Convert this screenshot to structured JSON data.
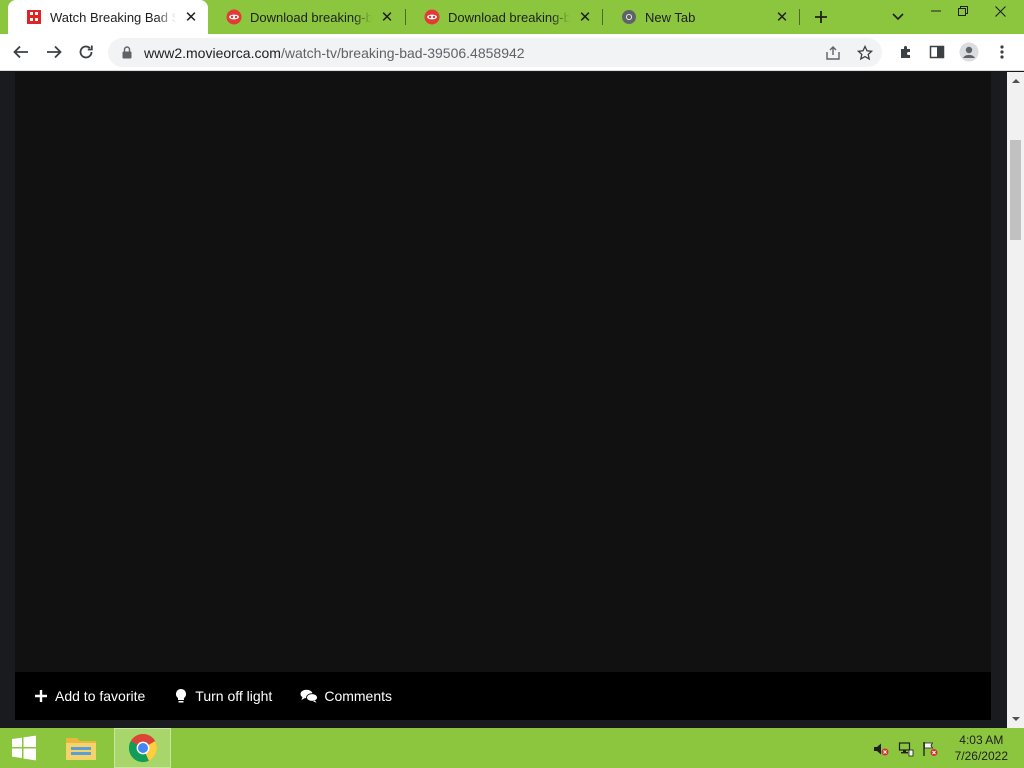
{
  "browser": {
    "tabs": [
      {
        "title": "Watch Breaking Bad Season",
        "favicon": "movieorca-icon",
        "active": true
      },
      {
        "title": "Download breaking-bad-s",
        "favicon": "download-site-icon",
        "active": false
      },
      {
        "title": "Download breaking-bad-s",
        "favicon": "download-site-icon",
        "active": false
      },
      {
        "title": "New Tab",
        "favicon": "chrome-icon",
        "active": false
      }
    ],
    "url_host": "www2.movieorca.com",
    "url_path": "/watch-tv/breaking-bad-39506.4858942"
  },
  "player": {
    "actions": [
      {
        "label": "Add to favorite",
        "icon": "plus-icon"
      },
      {
        "label": "Turn off light",
        "icon": "lightbulb-icon"
      },
      {
        "label": "Comments",
        "icon": "comments-icon"
      }
    ]
  },
  "taskbar": {
    "time": "4:03 AM",
    "date": "7/26/2022"
  },
  "colors": {
    "accent_green": "#8cc63f",
    "player_bg": "#111111",
    "player_bar_bg": "#000000"
  }
}
